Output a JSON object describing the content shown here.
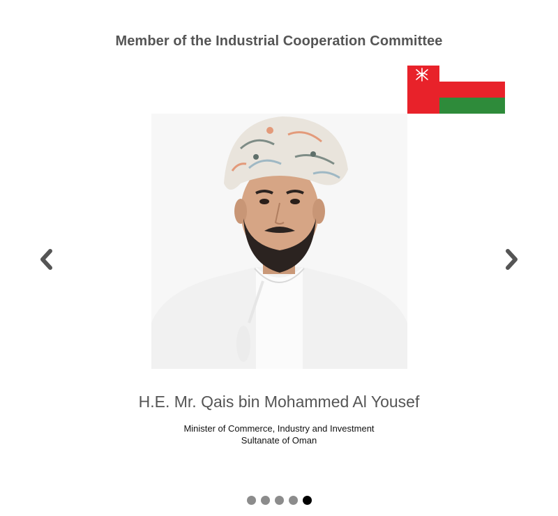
{
  "slide": {
    "heading": "Member of the Industrial Cooperation Committee",
    "flag_icon": "oman-flag-icon",
    "photo_icon": "portrait-photo",
    "name": "H.E. Mr. Qais bin Mohammed Al Yousef",
    "role_line1": "Minister of Commerce, Industry and Investment",
    "role_line2": "Sultanate of Oman"
  },
  "navigation": {
    "prev_icon": "chevron-left-icon",
    "next_icon": "chevron-right-icon"
  },
  "pagination": {
    "total": 5,
    "active_index": 4
  },
  "colors": {
    "flag_red": "#e8222a",
    "flag_green": "#2e8b3a",
    "flag_white": "#ffffff",
    "arrow": "#555555",
    "dot_inactive": "#8c8c8c",
    "dot_active": "#000000"
  }
}
